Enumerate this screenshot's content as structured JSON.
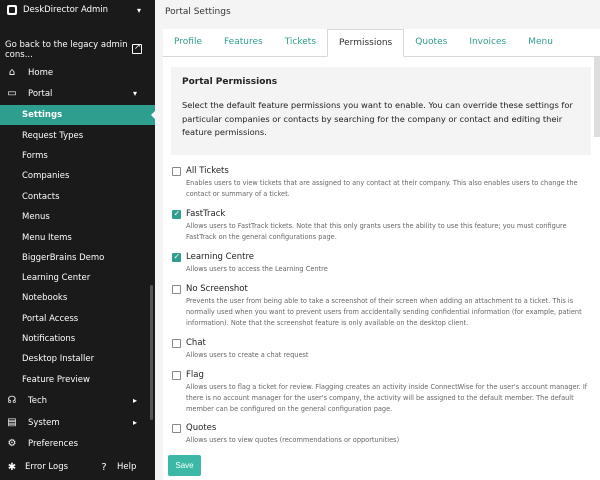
{
  "sidebar": {
    "app_title": "DeskDirector Admin",
    "legacy_link": "Go back to the legacy admin cons...",
    "home": "Home",
    "portal": "Portal",
    "portal_items": [
      "Settings",
      "Request Types",
      "Forms",
      "Companies",
      "Contacts",
      "Menus",
      "Menu Items",
      "BiggerBrains Demo",
      "Learning Center",
      "Notebooks",
      "Portal Access",
      "Notifications",
      "Desktop Installer",
      "Feature Preview"
    ],
    "tech": "Tech",
    "system": "System",
    "preferences": "Preferences",
    "error_logs": "Error Logs",
    "help": "Help"
  },
  "header": {
    "title": "Portal Settings"
  },
  "tabs": [
    "Profile",
    "Features",
    "Tickets",
    "Permissions",
    "Quotes",
    "Invoices",
    "Menu"
  ],
  "active_tab": "Permissions",
  "intro": {
    "heading": "Portal Permissions",
    "text": "Select the default feature permissions you want to enable. You can override these settings for particular companies or contacts by searching for the company or contact and editing their feature permissions."
  },
  "permissions": [
    {
      "label": "All Tickets",
      "checked": false,
      "desc": "Enables users to view tickets that are assigned to any contact at their company. This also enables users to change the contact or summary of a ticket."
    },
    {
      "label": "FastTrack",
      "checked": true,
      "desc": "Allows users to FastTrack tickets. Note that this only grants users the ability to use this feature; you must configure FastTrack on the general configurations page."
    },
    {
      "label": "Learning Centre",
      "checked": true,
      "desc": "Allows users to access the Learning Centre"
    },
    {
      "label": "No Screenshot",
      "checked": false,
      "desc": "Prevents the user from being able to take a screenshot of their screen when adding an attachment to a ticket. This is normally used when you want to prevent users from accidentally sending confidential information (for example, patient information). Note that the screenshot feature is only available on the desktop client."
    },
    {
      "label": "Chat",
      "checked": false,
      "desc": "Allows users to create a chat request"
    },
    {
      "label": "Flag",
      "checked": false,
      "desc": "Allows users to flag a ticket for review. Flagging creates an activity inside ConnectWise for the user's account manager. If there is no account manager for the user's company, the activity will be assigned to the default member. The default member can be configured on the general configuration page."
    },
    {
      "label": "Quotes",
      "checked": false,
      "desc": "Allows users to view quotes (recommendations or opportunities)"
    }
  ],
  "save_label": "Save",
  "colors": {
    "accent": "#2e9e8e",
    "sidebar_bg": "#1a1a1a"
  }
}
